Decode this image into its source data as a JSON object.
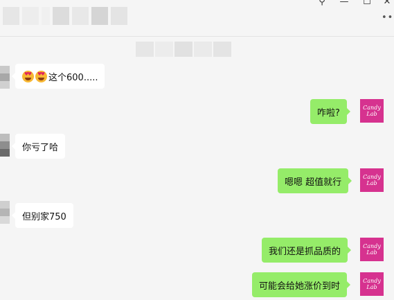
{
  "window": {
    "pin_glyph": "⚲",
    "minimize_glyph": "—",
    "maximize_glyph": "☐",
    "close_glyph": "✕",
    "more_glyph": "•••"
  },
  "chat": {
    "messages": [
      {
        "side": "left",
        "text": "这个600.....",
        "emoji": [
          "heart-eyes-emoji",
          "heart-eyes-emoji"
        ]
      },
      {
        "side": "right",
        "text": "咋啦?"
      },
      {
        "side": "left",
        "text": "你亏了哈"
      },
      {
        "side": "right",
        "text": "嗯嗯 超值就行"
      },
      {
        "side": "left",
        "text": "但别家750"
      },
      {
        "side": "right",
        "text": "我们还是抓品质的"
      },
      {
        "side": "right",
        "text": "可能会给她涨价到时"
      }
    ],
    "avatar_logo_text": [
      "Candy",
      "Lab"
    ]
  },
  "colors": {
    "self_bubble": "#95ec69",
    "other_bubble": "#ffffff",
    "avatar_brand": "#d6328f",
    "background": "#f5f5f5"
  }
}
